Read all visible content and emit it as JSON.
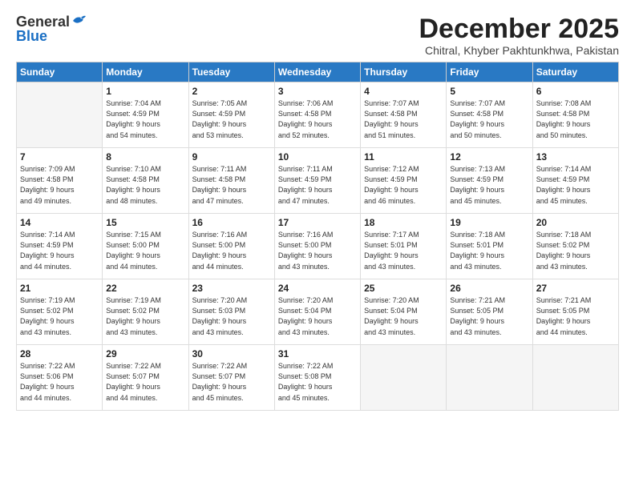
{
  "header": {
    "logo_general": "General",
    "logo_blue": "Blue",
    "title": "December 2025",
    "subtitle": "Chitral, Khyber Pakhtunkhwa, Pakistan"
  },
  "days_of_week": [
    "Sunday",
    "Monday",
    "Tuesday",
    "Wednesday",
    "Thursday",
    "Friday",
    "Saturday"
  ],
  "weeks": [
    [
      {
        "day": "",
        "info": ""
      },
      {
        "day": "1",
        "info": "Sunrise: 7:04 AM\nSunset: 4:59 PM\nDaylight: 9 hours\nand 54 minutes."
      },
      {
        "day": "2",
        "info": "Sunrise: 7:05 AM\nSunset: 4:59 PM\nDaylight: 9 hours\nand 53 minutes."
      },
      {
        "day": "3",
        "info": "Sunrise: 7:06 AM\nSunset: 4:58 PM\nDaylight: 9 hours\nand 52 minutes."
      },
      {
        "day": "4",
        "info": "Sunrise: 7:07 AM\nSunset: 4:58 PM\nDaylight: 9 hours\nand 51 minutes."
      },
      {
        "day": "5",
        "info": "Sunrise: 7:07 AM\nSunset: 4:58 PM\nDaylight: 9 hours\nand 50 minutes."
      },
      {
        "day": "6",
        "info": "Sunrise: 7:08 AM\nSunset: 4:58 PM\nDaylight: 9 hours\nand 50 minutes."
      }
    ],
    [
      {
        "day": "7",
        "info": "Sunrise: 7:09 AM\nSunset: 4:58 PM\nDaylight: 9 hours\nand 49 minutes."
      },
      {
        "day": "8",
        "info": "Sunrise: 7:10 AM\nSunset: 4:58 PM\nDaylight: 9 hours\nand 48 minutes."
      },
      {
        "day": "9",
        "info": "Sunrise: 7:11 AM\nSunset: 4:58 PM\nDaylight: 9 hours\nand 47 minutes."
      },
      {
        "day": "10",
        "info": "Sunrise: 7:11 AM\nSunset: 4:59 PM\nDaylight: 9 hours\nand 47 minutes."
      },
      {
        "day": "11",
        "info": "Sunrise: 7:12 AM\nSunset: 4:59 PM\nDaylight: 9 hours\nand 46 minutes."
      },
      {
        "day": "12",
        "info": "Sunrise: 7:13 AM\nSunset: 4:59 PM\nDaylight: 9 hours\nand 45 minutes."
      },
      {
        "day": "13",
        "info": "Sunrise: 7:14 AM\nSunset: 4:59 PM\nDaylight: 9 hours\nand 45 minutes."
      }
    ],
    [
      {
        "day": "14",
        "info": "Sunrise: 7:14 AM\nSunset: 4:59 PM\nDaylight: 9 hours\nand 44 minutes."
      },
      {
        "day": "15",
        "info": "Sunrise: 7:15 AM\nSunset: 5:00 PM\nDaylight: 9 hours\nand 44 minutes."
      },
      {
        "day": "16",
        "info": "Sunrise: 7:16 AM\nSunset: 5:00 PM\nDaylight: 9 hours\nand 44 minutes."
      },
      {
        "day": "17",
        "info": "Sunrise: 7:16 AM\nSunset: 5:00 PM\nDaylight: 9 hours\nand 43 minutes."
      },
      {
        "day": "18",
        "info": "Sunrise: 7:17 AM\nSunset: 5:01 PM\nDaylight: 9 hours\nand 43 minutes."
      },
      {
        "day": "19",
        "info": "Sunrise: 7:18 AM\nSunset: 5:01 PM\nDaylight: 9 hours\nand 43 minutes."
      },
      {
        "day": "20",
        "info": "Sunrise: 7:18 AM\nSunset: 5:02 PM\nDaylight: 9 hours\nand 43 minutes."
      }
    ],
    [
      {
        "day": "21",
        "info": "Sunrise: 7:19 AM\nSunset: 5:02 PM\nDaylight: 9 hours\nand 43 minutes."
      },
      {
        "day": "22",
        "info": "Sunrise: 7:19 AM\nSunset: 5:02 PM\nDaylight: 9 hours\nand 43 minutes."
      },
      {
        "day": "23",
        "info": "Sunrise: 7:20 AM\nSunset: 5:03 PM\nDaylight: 9 hours\nand 43 minutes."
      },
      {
        "day": "24",
        "info": "Sunrise: 7:20 AM\nSunset: 5:04 PM\nDaylight: 9 hours\nand 43 minutes."
      },
      {
        "day": "25",
        "info": "Sunrise: 7:20 AM\nSunset: 5:04 PM\nDaylight: 9 hours\nand 43 minutes."
      },
      {
        "day": "26",
        "info": "Sunrise: 7:21 AM\nSunset: 5:05 PM\nDaylight: 9 hours\nand 43 minutes."
      },
      {
        "day": "27",
        "info": "Sunrise: 7:21 AM\nSunset: 5:05 PM\nDaylight: 9 hours\nand 44 minutes."
      }
    ],
    [
      {
        "day": "28",
        "info": "Sunrise: 7:22 AM\nSunset: 5:06 PM\nDaylight: 9 hours\nand 44 minutes."
      },
      {
        "day": "29",
        "info": "Sunrise: 7:22 AM\nSunset: 5:07 PM\nDaylight: 9 hours\nand 44 minutes."
      },
      {
        "day": "30",
        "info": "Sunrise: 7:22 AM\nSunset: 5:07 PM\nDaylight: 9 hours\nand 45 minutes."
      },
      {
        "day": "31",
        "info": "Sunrise: 7:22 AM\nSunset: 5:08 PM\nDaylight: 9 hours\nand 45 minutes."
      },
      {
        "day": "",
        "info": ""
      },
      {
        "day": "",
        "info": ""
      },
      {
        "day": "",
        "info": ""
      }
    ]
  ]
}
